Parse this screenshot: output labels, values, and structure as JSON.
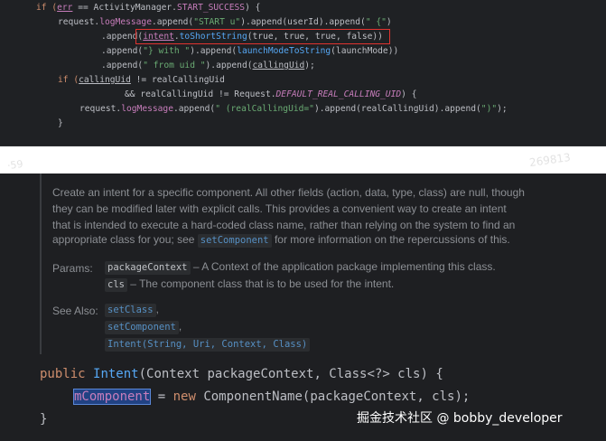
{
  "top_code": {
    "line1": {
      "a": "if (",
      "b": "err",
      "c": " == ActivityManager.",
      "d": "START_SUCCESS",
      "e": ") {"
    },
    "line2": {
      "a": "request.",
      "b": "logMessage",
      "c": ".append(",
      "d": "\"START u\"",
      "e": ").append(userId).append(",
      "f": "\" {\"",
      "g": ")"
    },
    "line3": {
      "a": ".append(",
      "b": "intent",
      "c": ".",
      "d": "toShortString",
      "e": "(true, true, true, false))"
    },
    "line4": {
      "a": ".append(",
      "b": "\"} with \"",
      "c": ").append(",
      "d": "launchModeToString",
      "e": "(launchMode))"
    },
    "line5": {
      "a": ".append(",
      "b": "\" from uid \"",
      "c": ").append(",
      "d": "callingUid",
      "e": ");"
    },
    "line6": {
      "a": "if (",
      "b": "callingUid",
      "c": " != realCallingUid"
    },
    "line7": {
      "a": "&& realCallingUid != Request.",
      "b": "DEFAULT_REAL_CALLING_UID",
      "c": ") {"
    },
    "line8": {
      "a": "request.",
      "b": "logMessage",
      "c": ".append(",
      "d": "\" (realCallingUid=\"",
      "e": ").append(realCallingUid).append(",
      "f": "\")\"",
      "g": ");"
    },
    "line9": {
      "a": "}"
    }
  },
  "watermarks": {
    "left": "·59",
    "right": "269813"
  },
  "doc": {
    "line1": "Create an intent for a specific component. All other fields (action, data, type, class) are null, though",
    "line2": "they can be modified later with explicit calls. This provides a convenient way to create an intent",
    "line3": "that is intended to execute a hard-coded class name, rather than relying on the system to find an",
    "line4_pre": "appropriate class for you; see ",
    "line4_link": "setComponent",
    "line4_post": " for more information on the repercussions of this.",
    "params_label": "Params:",
    "param1_name": "packageContext",
    "param1_desc": " – A Context of the application package implementing this class.",
    "param2_name": "cls",
    "param2_desc": " – The component class that is to be used for the intent.",
    "see_also_label": "See Also:",
    "see1": "setClass",
    "see2": "setComponent",
    "see3": "Intent(String, Uri, Context, Class)",
    "comma": ","
  },
  "big_code": {
    "line1": {
      "kw": "public ",
      "fn": "Intent",
      "rest": "(Context packageContext, Class<?> cls) {"
    },
    "line2": {
      "field": "mComponent",
      "eq": " = ",
      "kw": "new ",
      "rest": "ComponentName(packageContext, cls);"
    },
    "line3": "}"
  },
  "credit": "掘金技术社区 @ bobby_developer"
}
